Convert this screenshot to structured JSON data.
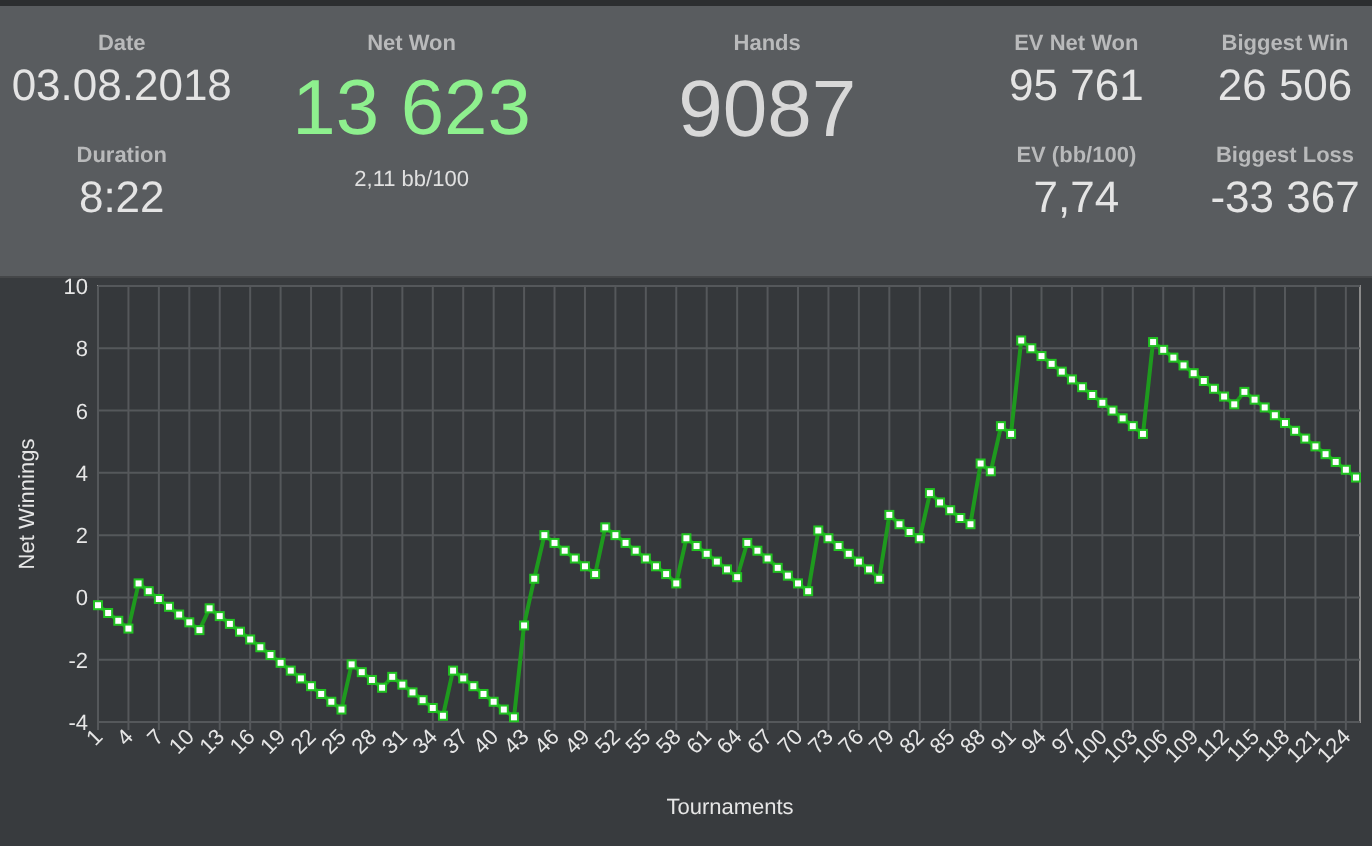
{
  "summary": {
    "date": {
      "label": "Date",
      "value": "03.08.2018"
    },
    "duration": {
      "label": "Duration",
      "value": "8:22"
    },
    "net_won": {
      "label": "Net Won",
      "value": "13 623",
      "sub": "2,11 bb/100"
    },
    "hands": {
      "label": "Hands",
      "value": "9087"
    },
    "ev_net_won": {
      "label": "EV Net Won",
      "value": "95 761"
    },
    "ev_bb100": {
      "label": "EV (bb/100)",
      "value": "7,74"
    },
    "biggest_win": {
      "label": "Biggest Win",
      "value": "26 506"
    },
    "biggest_loss": {
      "label": "Biggest Loss",
      "value": "-33 367"
    }
  },
  "chart": {
    "chart_data": {
      "type": "line",
      "xlabel": "Tournaments",
      "ylabel": "Net Winnings",
      "x": [
        1,
        2,
        3,
        4,
        5,
        6,
        7,
        8,
        9,
        10,
        11,
        12,
        13,
        14,
        15,
        16,
        17,
        18,
        19,
        20,
        21,
        22,
        23,
        24,
        25,
        26,
        27,
        28,
        29,
        30,
        31,
        32,
        33,
        34,
        35,
        36,
        37,
        38,
        39,
        40,
        41,
        42,
        43,
        44,
        45,
        46,
        47,
        48,
        49,
        50,
        51,
        52,
        53,
        54,
        55,
        56,
        57,
        58,
        59,
        60,
        61,
        62,
        63,
        64,
        65,
        66,
        67,
        68,
        69,
        70,
        71,
        72,
        73,
        74,
        75,
        76,
        77,
        78,
        79,
        80,
        81,
        82,
        83,
        84,
        85,
        86,
        87,
        88,
        89,
        90,
        91,
        92,
        93,
        94,
        95,
        96,
        97,
        98,
        99,
        100,
        101,
        102,
        103,
        104,
        105,
        106,
        107,
        108,
        109,
        110,
        111,
        112,
        113,
        114,
        115,
        116,
        117,
        118,
        119,
        120,
        121,
        122,
        123,
        124,
        125
      ],
      "grid": true,
      "series": [
        {
          "color": "#1e9a1e",
          "marker": true,
          "values": [
            -0.25,
            -0.5,
            -0.75,
            -1.0,
            0.45,
            0.2,
            -0.05,
            -0.3,
            -0.55,
            -0.8,
            -1.05,
            -0.35,
            -0.6,
            -0.85,
            -1.1,
            -1.35,
            -1.6,
            -1.85,
            -2.1,
            -2.35,
            -2.6,
            -2.85,
            -3.1,
            -3.35,
            -3.6,
            -2.15,
            -2.4,
            -2.65,
            -2.9,
            -2.55,
            -2.8,
            -3.05,
            -3.3,
            -3.55,
            -3.8,
            -2.35,
            -2.6,
            -2.85,
            -3.1,
            -3.35,
            -3.6,
            -3.85,
            -0.9,
            0.6,
            2.0,
            1.75,
            1.5,
            1.25,
            1.0,
            0.75,
            2.25,
            2.0,
            1.75,
            1.5,
            1.25,
            1.0,
            0.75,
            0.45,
            1.9,
            1.65,
            1.4,
            1.15,
            0.9,
            0.65,
            1.75,
            1.5,
            1.25,
            0.95,
            0.7,
            0.45,
            0.2,
            2.15,
            1.9,
            1.65,
            1.4,
            1.15,
            0.9,
            0.6,
            2.65,
            2.35,
            2.1,
            1.9,
            3.35,
            3.05,
            2.8,
            2.55,
            2.35,
            4.3,
            4.05,
            5.5,
            5.25,
            8.25,
            8.0,
            7.75,
            7.5,
            7.25,
            7.0,
            6.75,
            6.5,
            6.25,
            6.0,
            5.75,
            5.5,
            5.25,
            8.2,
            7.95,
            7.7,
            7.45,
            7.2,
            6.95,
            6.7,
            6.45,
            6.2,
            6.6,
            6.35,
            6.1,
            5.85,
            5.6,
            5.35,
            5.1,
            4.85,
            4.6,
            4.35,
            4.1,
            3.85
          ]
        }
      ],
      "xlim": [
        1,
        125
      ],
      "ylim": [
        -4,
        10
      ],
      "xticks": [
        1,
        4,
        7,
        10,
        13,
        16,
        19,
        22,
        25,
        28,
        31,
        34,
        37,
        40,
        43,
        46,
        49,
        52,
        55,
        58,
        61,
        64,
        67,
        70,
        73,
        76,
        79,
        82,
        85,
        88,
        91,
        94,
        97,
        100,
        103,
        106,
        109,
        112,
        115,
        118,
        121,
        124
      ],
      "yticks": [
        -4,
        -2,
        0,
        2,
        4,
        6,
        8,
        10
      ]
    }
  }
}
